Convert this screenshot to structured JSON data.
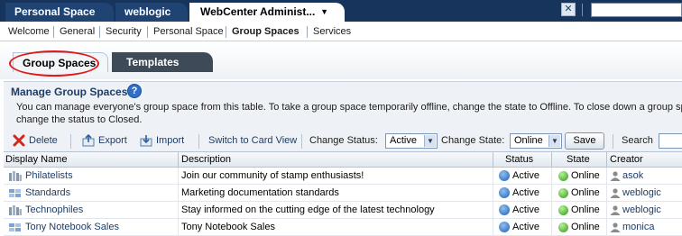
{
  "top_tabs": [
    "Personal Space",
    "weblogic",
    "WebCenter Administ..."
  ],
  "subnav": [
    "Welcome",
    "General",
    "Security",
    "Personal Space",
    "Group Spaces",
    "Services"
  ],
  "inner_tabs": [
    "Group Spaces",
    "Templates"
  ],
  "manage": {
    "title": "Manage Group Spaces",
    "help": "?",
    "description_line1": "You can manage everyone's group space from this table. To take a group space temporarily offline, change the state to Offline. To close down a group sp",
    "description_line2": "change the status to Closed."
  },
  "toolbar": {
    "delete": "Delete",
    "export": "Export",
    "import": "Import",
    "switch": "Switch to Card View",
    "change_status_label": "Change Status:",
    "status_value": "Active",
    "change_state_label": "Change State:",
    "state_value": "Online",
    "save": "Save",
    "search_label": "Search"
  },
  "table": {
    "columns": [
      "Display Name",
      "Description",
      "Status",
      "State",
      "Creator"
    ],
    "rows": [
      {
        "name": "Philatelists",
        "description": "Join our community of stamp enthusiasts!",
        "status": "Active",
        "state": "Online",
        "creator": "asok"
      },
      {
        "name": "Standards",
        "description": "Marketing documentation standards",
        "status": "Active",
        "state": "Online",
        "creator": "weblogic"
      },
      {
        "name": "Technophiles",
        "description": "Stay informed on the cutting edge of the latest technology",
        "status": "Active",
        "state": "Online",
        "creator": "weblogic"
      },
      {
        "name": "Tony Notebook Sales",
        "description": "Tony Notebook Sales",
        "status": "Active",
        "state": "Online",
        "creator": "monica"
      }
    ]
  },
  "colors": {
    "topbar": "#17345c",
    "link": "#1f3c66",
    "highlight_oval": "#e01a1a",
    "online": "#2e9b12"
  }
}
